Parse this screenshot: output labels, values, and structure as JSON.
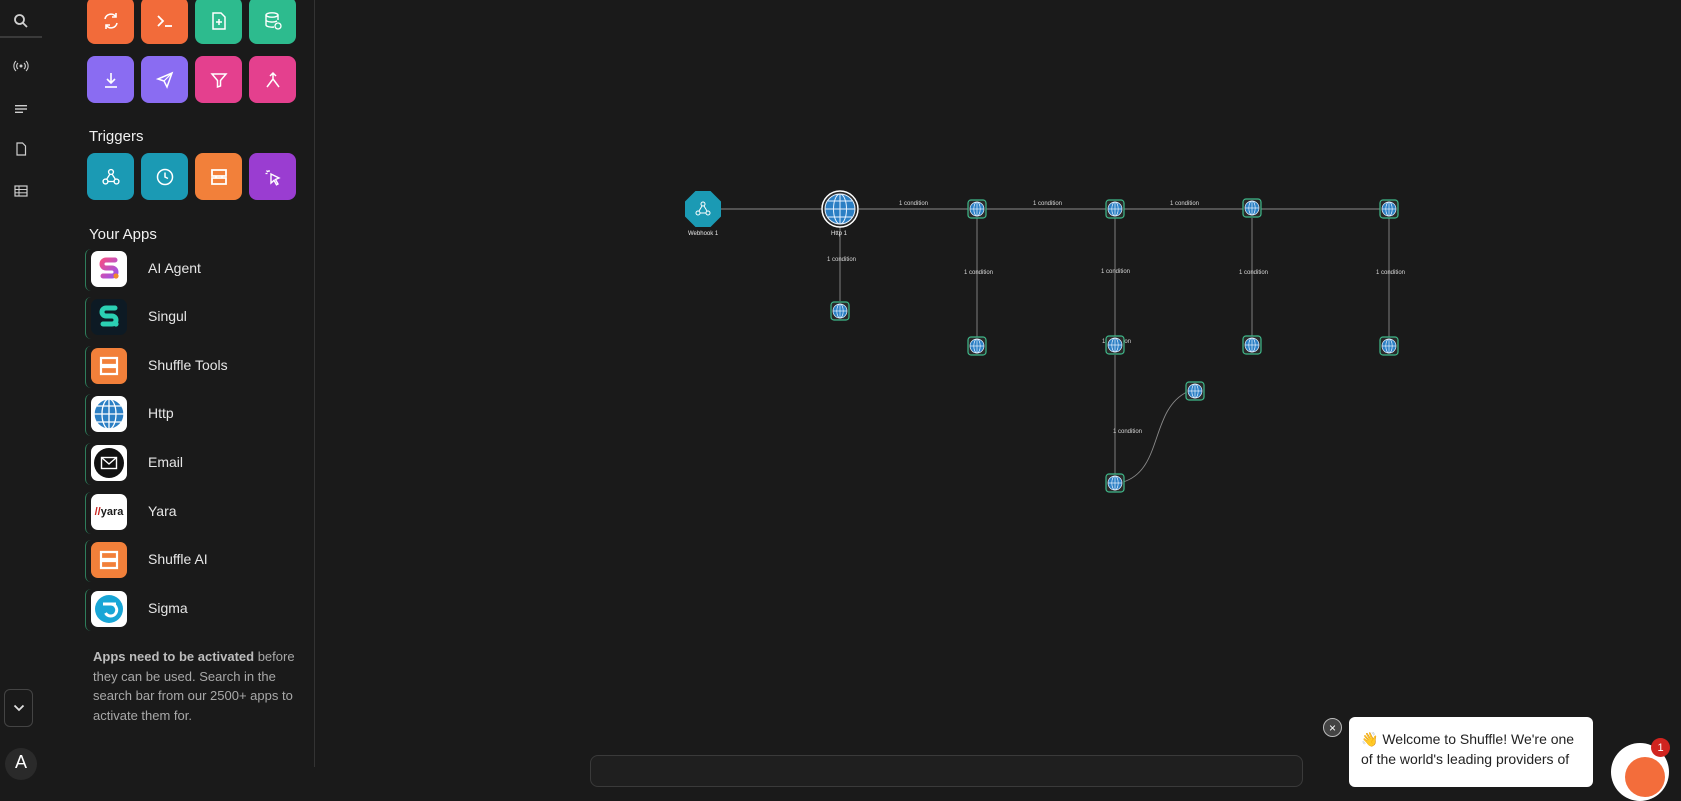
{
  "actions": {
    "row1": [
      {
        "icon": "refresh-icon",
        "color": "#f26b3a"
      },
      {
        "icon": "terminal-icon",
        "color": "#f26b3a"
      },
      {
        "icon": "file-add-icon",
        "color": "#2dbb8e"
      },
      {
        "icon": "database-icon",
        "color": "#2dbb8e"
      }
    ],
    "row2": [
      {
        "icon": "download-icon",
        "color": "#8a6cf2"
      },
      {
        "icon": "send-icon",
        "color": "#8a6cf2"
      },
      {
        "icon": "filter-icon",
        "color": "#e4408e"
      },
      {
        "icon": "merge-icon",
        "color": "#e4408e"
      }
    ]
  },
  "triggers": {
    "title": "Triggers",
    "items": [
      {
        "icon": "webhook-icon",
        "color": "#1b9ab4"
      },
      {
        "icon": "clock-icon",
        "color": "#1b9ab4"
      },
      {
        "icon": "shuffle-logo-icon",
        "color": "#f2803a"
      },
      {
        "icon": "pointer-click-icon",
        "color": "#9a3dd1"
      }
    ]
  },
  "apps": {
    "title": "Your Apps",
    "items": [
      {
        "name": "AI Agent",
        "icon": "ai-agent-logo"
      },
      {
        "name": "Singul",
        "icon": "singul-logo"
      },
      {
        "name": "Shuffle Tools",
        "icon": "shuffle-logo"
      },
      {
        "name": "Http",
        "icon": "globe-logo"
      },
      {
        "name": "Email",
        "icon": "email-logo"
      },
      {
        "name": "Yara",
        "icon": "yara-logo",
        "logo_text": "yara"
      },
      {
        "name": "Shuffle AI",
        "icon": "shuffle-logo"
      },
      {
        "name": "Sigma",
        "icon": "sigma-logo"
      }
    ]
  },
  "note": {
    "bold": "Apps need to be activated",
    "rest": " before they can be used. Search in the search bar from our 2500+ apps to activate them for."
  },
  "workflow": {
    "nodes": [
      {
        "id": "webhook",
        "label": "Webhook 1"
      },
      {
        "id": "http1",
        "label": "Http 1"
      }
    ],
    "edge_label": "1 condition"
  },
  "popup": {
    "text": "👋 Welcome to Shuffle! We're one of the world's leading providers of",
    "close": "×",
    "badge": "1"
  },
  "rail": {
    "avatar_letter": "A"
  }
}
